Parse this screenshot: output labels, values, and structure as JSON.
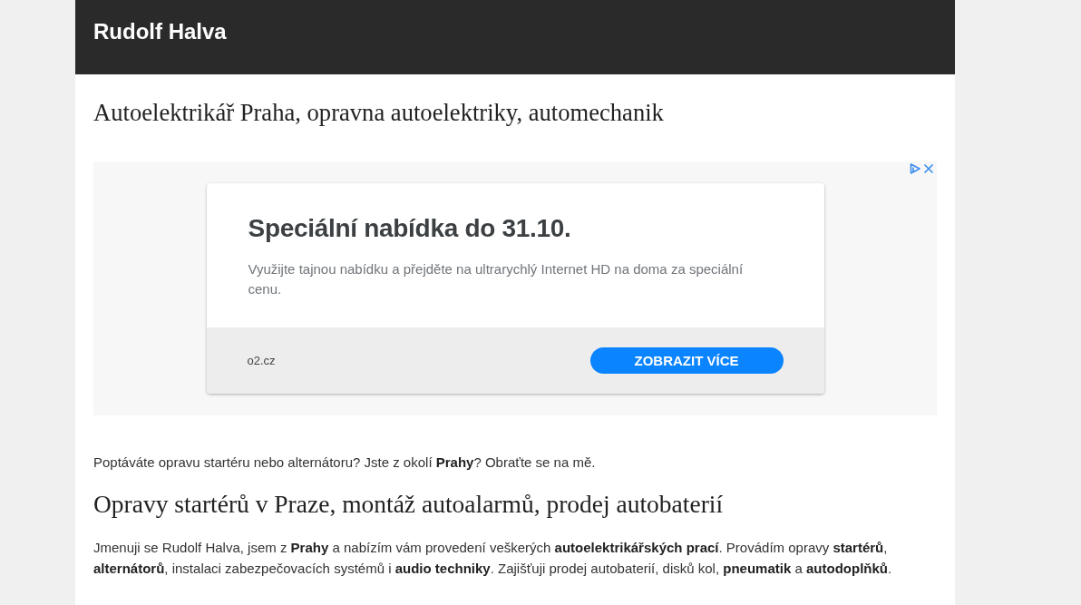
{
  "header": {
    "title": "Rudolf Halva"
  },
  "page_title": "Autoelektrikář Praha, opravna autoelektriky, automechanik",
  "ad": {
    "headline": "Speciální nabídka do 31.10.",
    "description": "Využijte tajnou nabídku a přejděte na ultrarychlý Internet HD na doma za speciální cenu.",
    "domain": "o2.cz",
    "button": "ZOBRAZIT VÍCE"
  },
  "content": [
    {
      "kind": "paragraph",
      "text": "Poptáváte opravu startéru nebo alternátoru? Jste z okolí **Prahy**? Obraťte se na mě."
    },
    {
      "kind": "heading",
      "text": "Opravy startérů v Praze, montáž autoalarmů, prodej autobaterií"
    },
    {
      "kind": "paragraph",
      "text": "Jmenuji se Rudolf Halva, jsem z **Prahy** a nabízím vám provedení veškerých **autoelektrikářských prací**. Provádím opravy **startérů**, **alternátorů**, instalaci zabezpečovacích systémů i **audio techniky**. Zajišťuji prodej autobaterií, disků kol, **pneumatik** a **autodoplňků**."
    }
  ]
}
